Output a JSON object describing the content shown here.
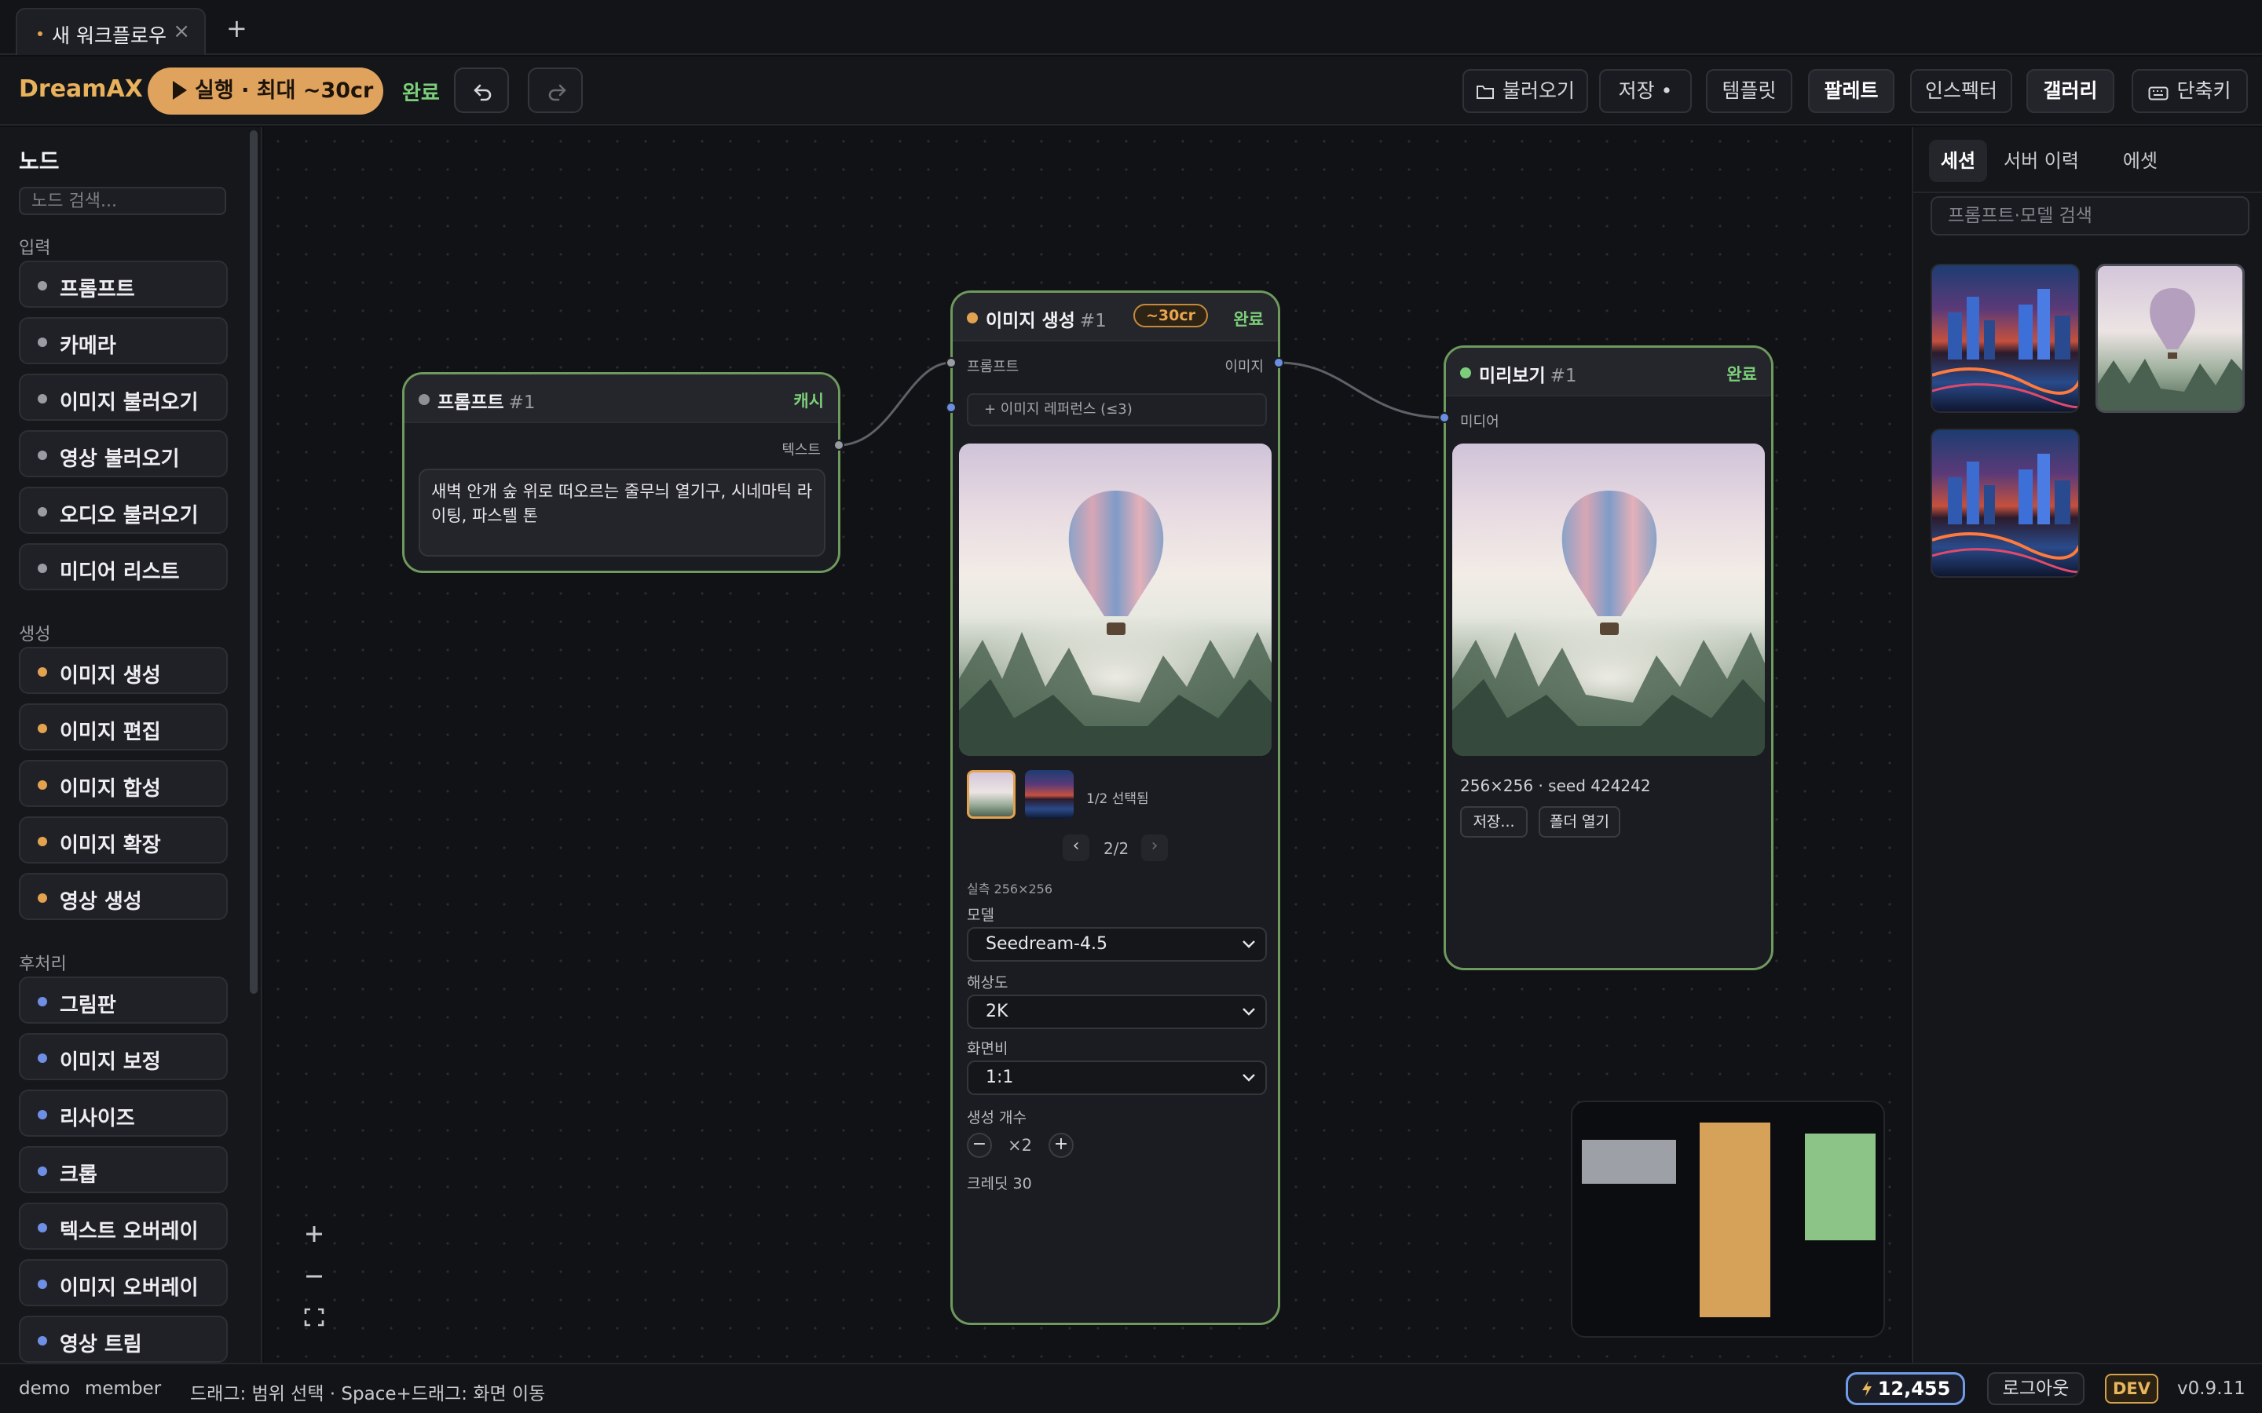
{
  "tabs": {
    "active_label": "새 워크플로우",
    "close_glyph": "×",
    "new_glyph": "+"
  },
  "toolbar": {
    "brand": "DreamAX",
    "run_label": "실행 · 최대 ~30cr",
    "status": "완료",
    "open_label": "불러오기",
    "save_label": "저장 •",
    "template_label": "템플릿",
    "palette_label": "팔레트",
    "inspector_label": "인스펙터",
    "gallery_label": "갤러리",
    "shortcuts_label": "단축키"
  },
  "sidebar": {
    "title": "노드",
    "search_placeholder": "노드 검색...",
    "sections": [
      {
        "label": "입력",
        "color": "#9a9ca3",
        "items": [
          "프롬프트",
          "카메라",
          "이미지 불러오기",
          "영상 불러오기",
          "오디오 불러오기",
          "미디어 리스트"
        ]
      },
      {
        "label": "생성",
        "color": "#e3a24f",
        "items": [
          "이미지 생성",
          "이미지 편집",
          "이미지 합성",
          "이미지 확장",
          "영상 생성"
        ]
      },
      {
        "label": "후처리",
        "color": "#6f8fe6",
        "items": [
          "그림판",
          "이미지 보정",
          "리사이즈",
          "크롭",
          "텍스트 오버레이",
          "이미지 오버레이",
          "영상 트림"
        ]
      }
    ]
  },
  "nodes": {
    "prompt": {
      "title": "프롬프트",
      "num": "#1",
      "status": "캐시",
      "status_color": "#7ccf7a",
      "out_label": "텍스트",
      "text": "새벽 안개 숲 위로 떠오르는 줄무늬 열기구, 시네마틱 라이팅, 파스텔 톤"
    },
    "gen": {
      "title": "이미지 생성",
      "num": "#1",
      "cost": "~30cr",
      "status": "완료",
      "in_label": "프롬프트",
      "out_label": "이미지",
      "ref_label": "+ 이미지 레퍼런스 (≤3)",
      "selected_count": "1/2 선택됨",
      "page": "2/2",
      "prev_glyph": "‹",
      "next_glyph": "›",
      "actual_size": "실측 256×256",
      "model_label": "모델",
      "model_value": "Seedream-4.5",
      "res_label": "해상도",
      "res_value": "2K",
      "aspect_label": "화면비",
      "aspect_value": "1:1",
      "count_label": "생성 개수",
      "count_value": "×2",
      "minus": "−",
      "plus": "+",
      "credit": "크레딧 30"
    },
    "preview": {
      "title": "미리보기",
      "num": "#1",
      "status": "완료",
      "in_label": "미디어",
      "meta": "256×256 · seed 424242",
      "save_btn": "저장...",
      "folder_btn": "폴더 열기"
    }
  },
  "minimap": {
    "colors": {
      "prompt": "#9ea0a8",
      "gen": "#d6a25a",
      "preview": "#8cc488"
    }
  },
  "right_panel": {
    "tabs": [
      "세션",
      "서버 이력",
      "에셋"
    ],
    "active_tab": 0,
    "search_placeholder": "프롬프트·모델 검색",
    "thumbs": [
      "city-night",
      "balloon",
      "city-night"
    ]
  },
  "statusbar": {
    "user": "demo",
    "role": "member",
    "hint": "드래그: 범위 선택 · Space+드래그: 화면 이동",
    "credits": "12,455",
    "logout": "로그아웃",
    "dev": "DEV",
    "version": "v0.9.11"
  },
  "icons": [
    "close-icon",
    "plus-icon",
    "play-icon",
    "undo-icon",
    "redo-icon",
    "folder-icon",
    "keyboard-icon",
    "chevron-down-icon",
    "zoom-in-icon",
    "zoom-out-icon",
    "fit-screen-icon",
    "bolt-icon"
  ]
}
